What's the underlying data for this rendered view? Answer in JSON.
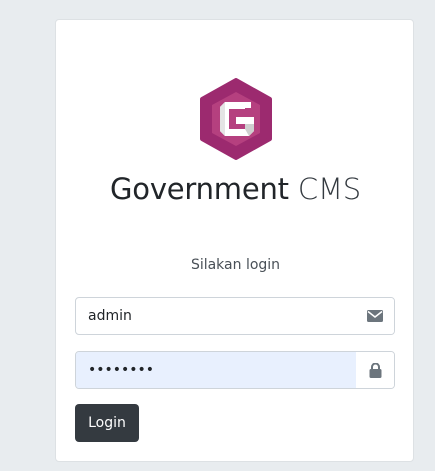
{
  "brand": {
    "name_bold": "Government",
    "name_light": "CMS",
    "logo_letter": "G",
    "logo_color": "#9c2a6f"
  },
  "login": {
    "prompt": "Silakan login",
    "username_value": "admin",
    "password_value": "••••••••",
    "username_icon": "envelope-icon",
    "password_icon": "lock-icon",
    "submit_label": "Login"
  },
  "colors": {
    "button": "#343a40",
    "autofill": "#e8f0fe"
  }
}
